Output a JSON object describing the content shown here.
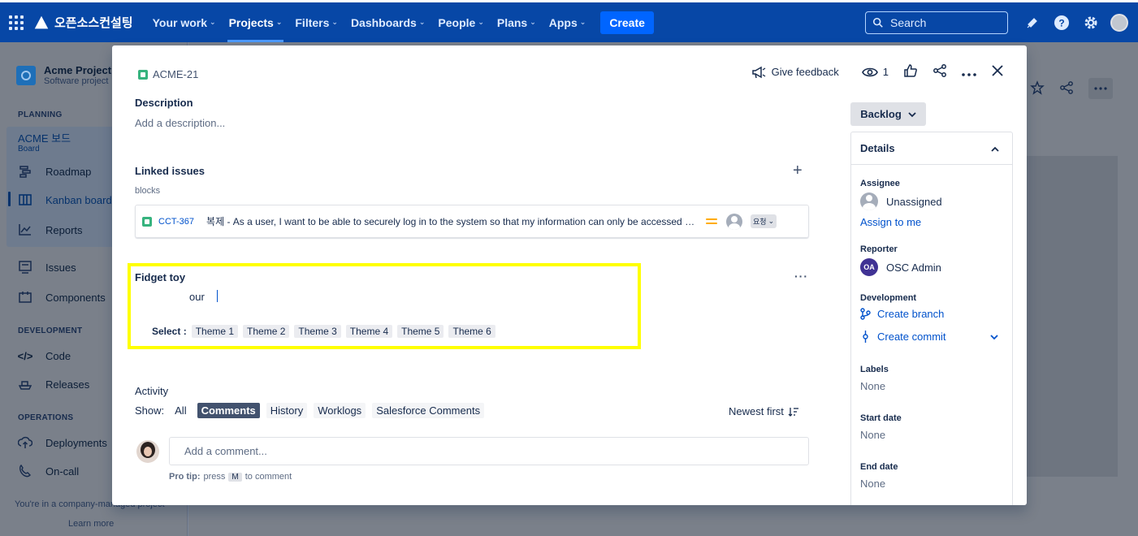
{
  "topnav": {
    "brand": "오픈소스컨설팅",
    "items": [
      {
        "label": "Your work",
        "active": false
      },
      {
        "label": "Projects",
        "active": true
      },
      {
        "label": "Filters",
        "active": false
      },
      {
        "label": "Dashboards",
        "active": false
      },
      {
        "label": "People",
        "active": false
      },
      {
        "label": "Plans",
        "active": false
      },
      {
        "label": "Apps",
        "active": false
      }
    ],
    "create_label": "Create",
    "search_placeholder": "Search"
  },
  "sidebar": {
    "project_name": "Acme Project",
    "project_type": "Software project",
    "planning_heading": "PLANNING",
    "board_title": "ACME 보드",
    "board_sub": "Board",
    "roadmap": "Roadmap",
    "kanban": "Kanban board",
    "reports": "Reports",
    "issues": "Issues",
    "components": "Components",
    "development_heading": "DEVELOPMENT",
    "code": "Code",
    "releases": "Releases",
    "operations_heading": "OPERATIONS",
    "deployments": "Deployments",
    "oncall": "On-call",
    "footer": "You're in a company-managed project",
    "learn_more": "Learn more"
  },
  "issue": {
    "key": "ACME-21",
    "give_feedback": "Give feedback",
    "watchers": "1",
    "description_label": "Description",
    "description_placeholder": "Add a description...",
    "linked_label": "Linked issues",
    "link_type": "blocks",
    "linked": {
      "key": "CCT-367",
      "summary": "복제 - As a user, I want to be able to securely log in to the system so that my information can only be accessed by me.",
      "status": "요청"
    },
    "fidget": {
      "title": "Fidget toy",
      "text": "our",
      "select_label": "Select :",
      "themes": [
        "Theme 1",
        "Theme 2",
        "Theme 3",
        "Theme 4",
        "Theme 5",
        "Theme 6"
      ]
    },
    "activity": {
      "label": "Activity",
      "show_label": "Show:",
      "tabs": [
        "All",
        "Comments",
        "History",
        "Worklogs",
        "Salesforce Comments"
      ],
      "selected_tab": "Comments",
      "sort": "Newest first",
      "comment_placeholder": "Add a comment...",
      "protip_bold": "Pro tip:",
      "protip_press": "press",
      "protip_key": "M",
      "protip_rest": "to comment"
    }
  },
  "details": {
    "status": "Backlog",
    "heading": "Details",
    "assignee_label": "Assignee",
    "assignee_value": "Unassigned",
    "assign_to_me": "Assign to me",
    "reporter_label": "Reporter",
    "reporter_initials": "OA",
    "reporter_value": "OSC Admin",
    "development_label": "Development",
    "create_branch": "Create branch",
    "create_commit": "Create commit",
    "labels_label": "Labels",
    "labels_value": "None",
    "start_label": "Start date",
    "start_value": "None",
    "end_label": "End date",
    "end_value": "None"
  },
  "colors": {
    "nav": "#0747a6",
    "highlight": "#ffff00",
    "link": "#0052cc"
  }
}
